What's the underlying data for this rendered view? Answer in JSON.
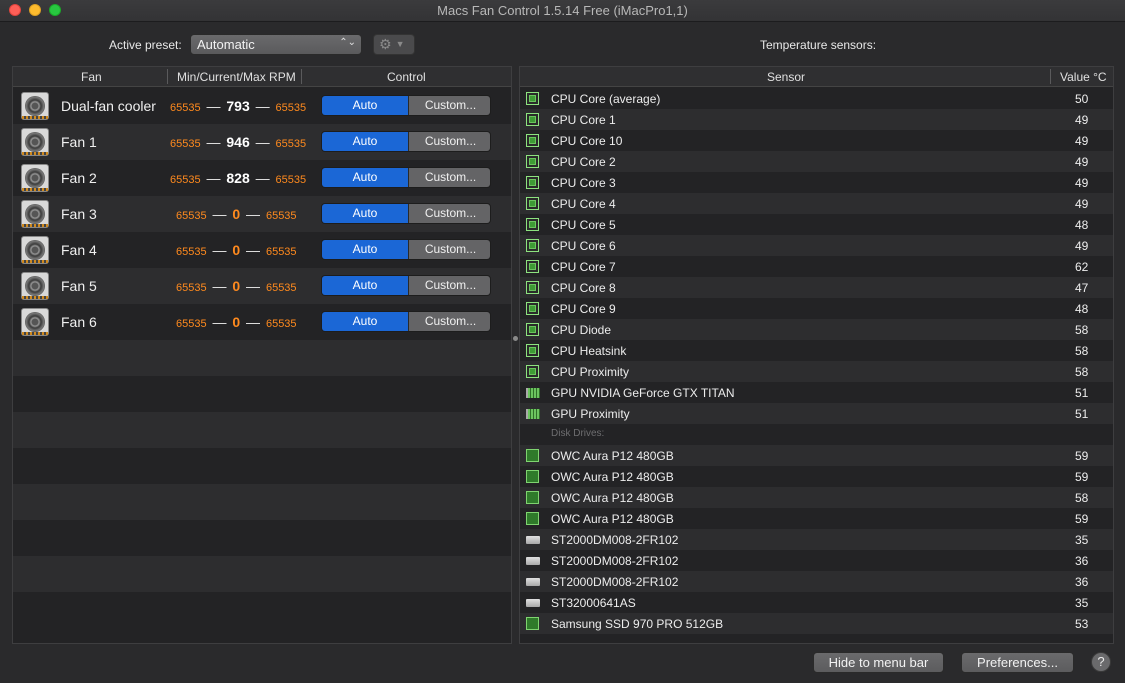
{
  "window": {
    "title": "Macs Fan Control 1.5.14 Free (iMacPro1,1)"
  },
  "preset": {
    "label": "Active preset:",
    "selected": "Automatic"
  },
  "sensors_label": "Temperature sensors:",
  "fan_table": {
    "headers": {
      "fan": "Fan",
      "rpm": "Min/Current/Max RPM",
      "control": "Control"
    },
    "rows": [
      {
        "name": "Dual-fan cooler",
        "min": "65535",
        "current": "793",
        "max": "65535",
        "auto": "Auto",
        "custom": "Custom..."
      },
      {
        "name": "Fan 1",
        "min": "65535",
        "current": "946",
        "max": "65535",
        "auto": "Auto",
        "custom": "Custom..."
      },
      {
        "name": "Fan 2",
        "min": "65535",
        "current": "828",
        "max": "65535",
        "auto": "Auto",
        "custom": "Custom..."
      },
      {
        "name": "Fan 3",
        "min": "65535",
        "current": "0",
        "max": "65535",
        "auto": "Auto",
        "custom": "Custom..."
      },
      {
        "name": "Fan 4",
        "min": "65535",
        "current": "0",
        "max": "65535",
        "auto": "Auto",
        "custom": "Custom..."
      },
      {
        "name": "Fan 5",
        "min": "65535",
        "current": "0",
        "max": "65535",
        "auto": "Auto",
        "custom": "Custom..."
      },
      {
        "name": "Fan 6",
        "min": "65535",
        "current": "0",
        "max": "65535",
        "auto": "Auto",
        "custom": "Custom..."
      }
    ]
  },
  "sensor_table": {
    "headers": {
      "sensor": "Sensor",
      "value": "Value °C"
    },
    "rows": [
      {
        "icon": "cpu",
        "name": "CPU Core (average)",
        "value": "50"
      },
      {
        "icon": "cpu",
        "name": "CPU Core 1",
        "value": "49"
      },
      {
        "icon": "cpu",
        "name": "CPU Core 10",
        "value": "49"
      },
      {
        "icon": "cpu",
        "name": "CPU Core 2",
        "value": "49"
      },
      {
        "icon": "cpu",
        "name": "CPU Core 3",
        "value": "49"
      },
      {
        "icon": "cpu",
        "name": "CPU Core 4",
        "value": "49"
      },
      {
        "icon": "cpu",
        "name": "CPU Core 5",
        "value": "48"
      },
      {
        "icon": "cpu",
        "name": "CPU Core 6",
        "value": "49"
      },
      {
        "icon": "cpu",
        "name": "CPU Core 7",
        "value": "62"
      },
      {
        "icon": "cpu",
        "name": "CPU Core 8",
        "value": "47"
      },
      {
        "icon": "cpu",
        "name": "CPU Core 9",
        "value": "48"
      },
      {
        "icon": "cpu",
        "name": "CPU Diode",
        "value": "58"
      },
      {
        "icon": "cpu",
        "name": "CPU Heatsink",
        "value": "58"
      },
      {
        "icon": "cpu",
        "name": "CPU Proximity",
        "value": "58"
      },
      {
        "icon": "gpu",
        "name": "GPU NVIDIA GeForce GTX TITAN",
        "value": "51"
      },
      {
        "icon": "gpu",
        "name": "GPU Proximity",
        "value": "51"
      },
      {
        "icon": "group",
        "name": "Disk Drives:",
        "value": ""
      },
      {
        "icon": "ssd",
        "name": "OWC Aura P12 480GB",
        "value": "59"
      },
      {
        "icon": "ssd",
        "name": "OWC Aura P12 480GB",
        "value": "59"
      },
      {
        "icon": "ssd",
        "name": "OWC Aura P12 480GB",
        "value": "58"
      },
      {
        "icon": "ssd",
        "name": "OWC Aura P12 480GB",
        "value": "59"
      },
      {
        "icon": "hdd",
        "name": "ST2000DM008-2FR102",
        "value": "35"
      },
      {
        "icon": "hdd",
        "name": "ST2000DM008-2FR102",
        "value": "36"
      },
      {
        "icon": "hdd",
        "name": "ST2000DM008-2FR102",
        "value": "36"
      },
      {
        "icon": "hdd",
        "name": "ST32000641AS",
        "value": "35"
      },
      {
        "icon": "ssd",
        "name": "Samsung SSD 970 PRO 512GB",
        "value": "53"
      }
    ]
  },
  "footer": {
    "hide_label": "Hide to menu bar",
    "prefs_label": "Preferences...",
    "help_label": "?"
  },
  "colors": {
    "accent": "#1b67d6",
    "rpm_orange": "#ff8a1e",
    "cpu_green": "#3e9a35"
  }
}
